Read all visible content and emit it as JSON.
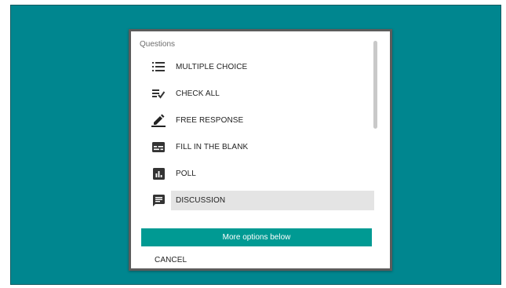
{
  "dialog": {
    "section_label": "Questions",
    "items": [
      {
        "label": "MULTIPLE CHOICE",
        "icon": "list-icon"
      },
      {
        "label": "CHECK ALL",
        "icon": "checklist-icon"
      },
      {
        "label": "FREE RESPONSE",
        "icon": "pencil-icon"
      },
      {
        "label": "FILL IN THE BLANK",
        "icon": "blank-field-icon"
      },
      {
        "label": "POLL",
        "icon": "poll-icon"
      },
      {
        "label": "DISCUSSION",
        "icon": "chat-icon",
        "selected": true
      }
    ],
    "more_options_label": "More options below",
    "cancel_label": "CANCEL"
  },
  "colors": {
    "background": "#00868f",
    "accent": "#009a93",
    "selected_row": "#e4e4e4"
  }
}
